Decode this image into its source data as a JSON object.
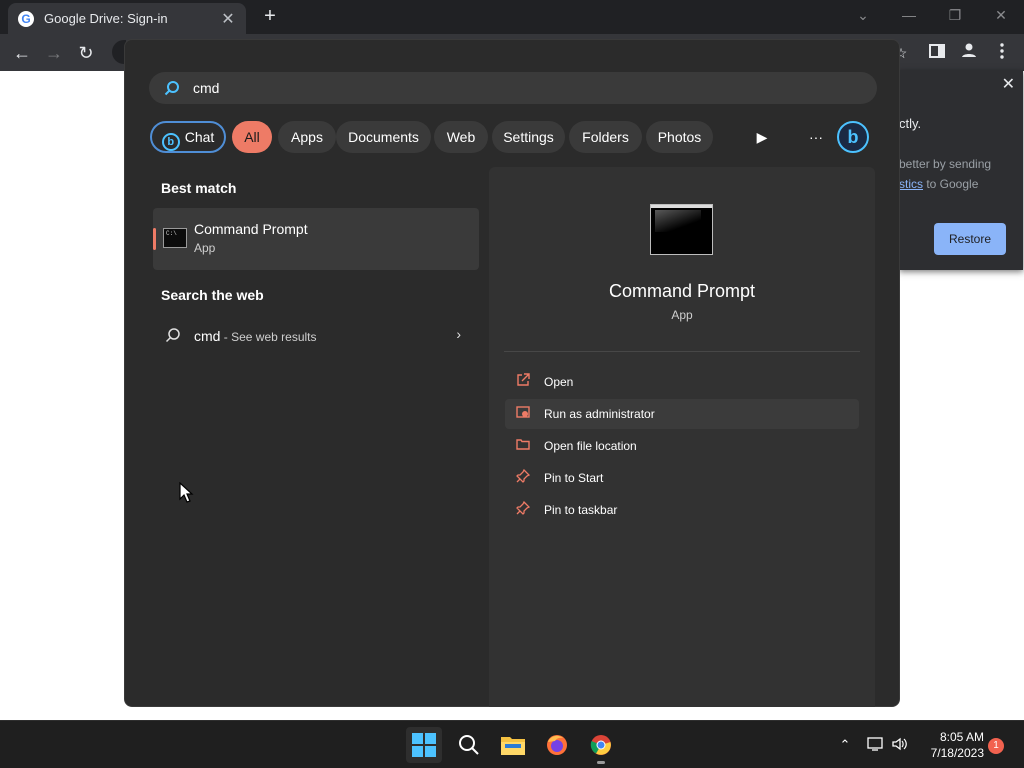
{
  "browser": {
    "tab_title": "Google Drive: Sign-in",
    "tab_close_glyph": "✕",
    "new_tab_glyph": "+",
    "favicon_letter": "G"
  },
  "restore_bubble": {
    "line1": "ctly.",
    "line2": "better by sending",
    "line3_link": "stics",
    "line3_rest": " to Google",
    "restore_label": "Restore"
  },
  "search": {
    "query": "cmd",
    "filters": {
      "chat": "Chat",
      "all": "All",
      "apps": "Apps",
      "documents": "Documents",
      "web": "Web",
      "settings": "Settings",
      "folders": "Folders",
      "photos": "Photos"
    },
    "more_glyph": "···",
    "best_match_heading": "Best match",
    "best_match": {
      "name": "Command Prompt",
      "kind": "App"
    },
    "web_heading": "Search the web",
    "web_result": {
      "query": "cmd",
      "suffix": " - See web results"
    }
  },
  "details": {
    "name": "Command Prompt",
    "kind": "App",
    "actions": [
      {
        "label": "Open",
        "icon": "open-external-icon"
      },
      {
        "label": "Run as administrator",
        "icon": "shield-admin-icon"
      },
      {
        "label": "Open file location",
        "icon": "folder-icon"
      },
      {
        "label": "Pin to Start",
        "icon": "pin-icon"
      },
      {
        "label": "Pin to taskbar",
        "icon": "pin-icon"
      }
    ]
  },
  "taskbar": {
    "time": "8:05 AM",
    "date": "7/18/2023",
    "notification_count": "1"
  },
  "colors": {
    "accent": "#ee7b66",
    "search_accent": "#4cc2ff",
    "panel_bg": "#2b2b2b",
    "restore_button": "#8ab4f8"
  }
}
